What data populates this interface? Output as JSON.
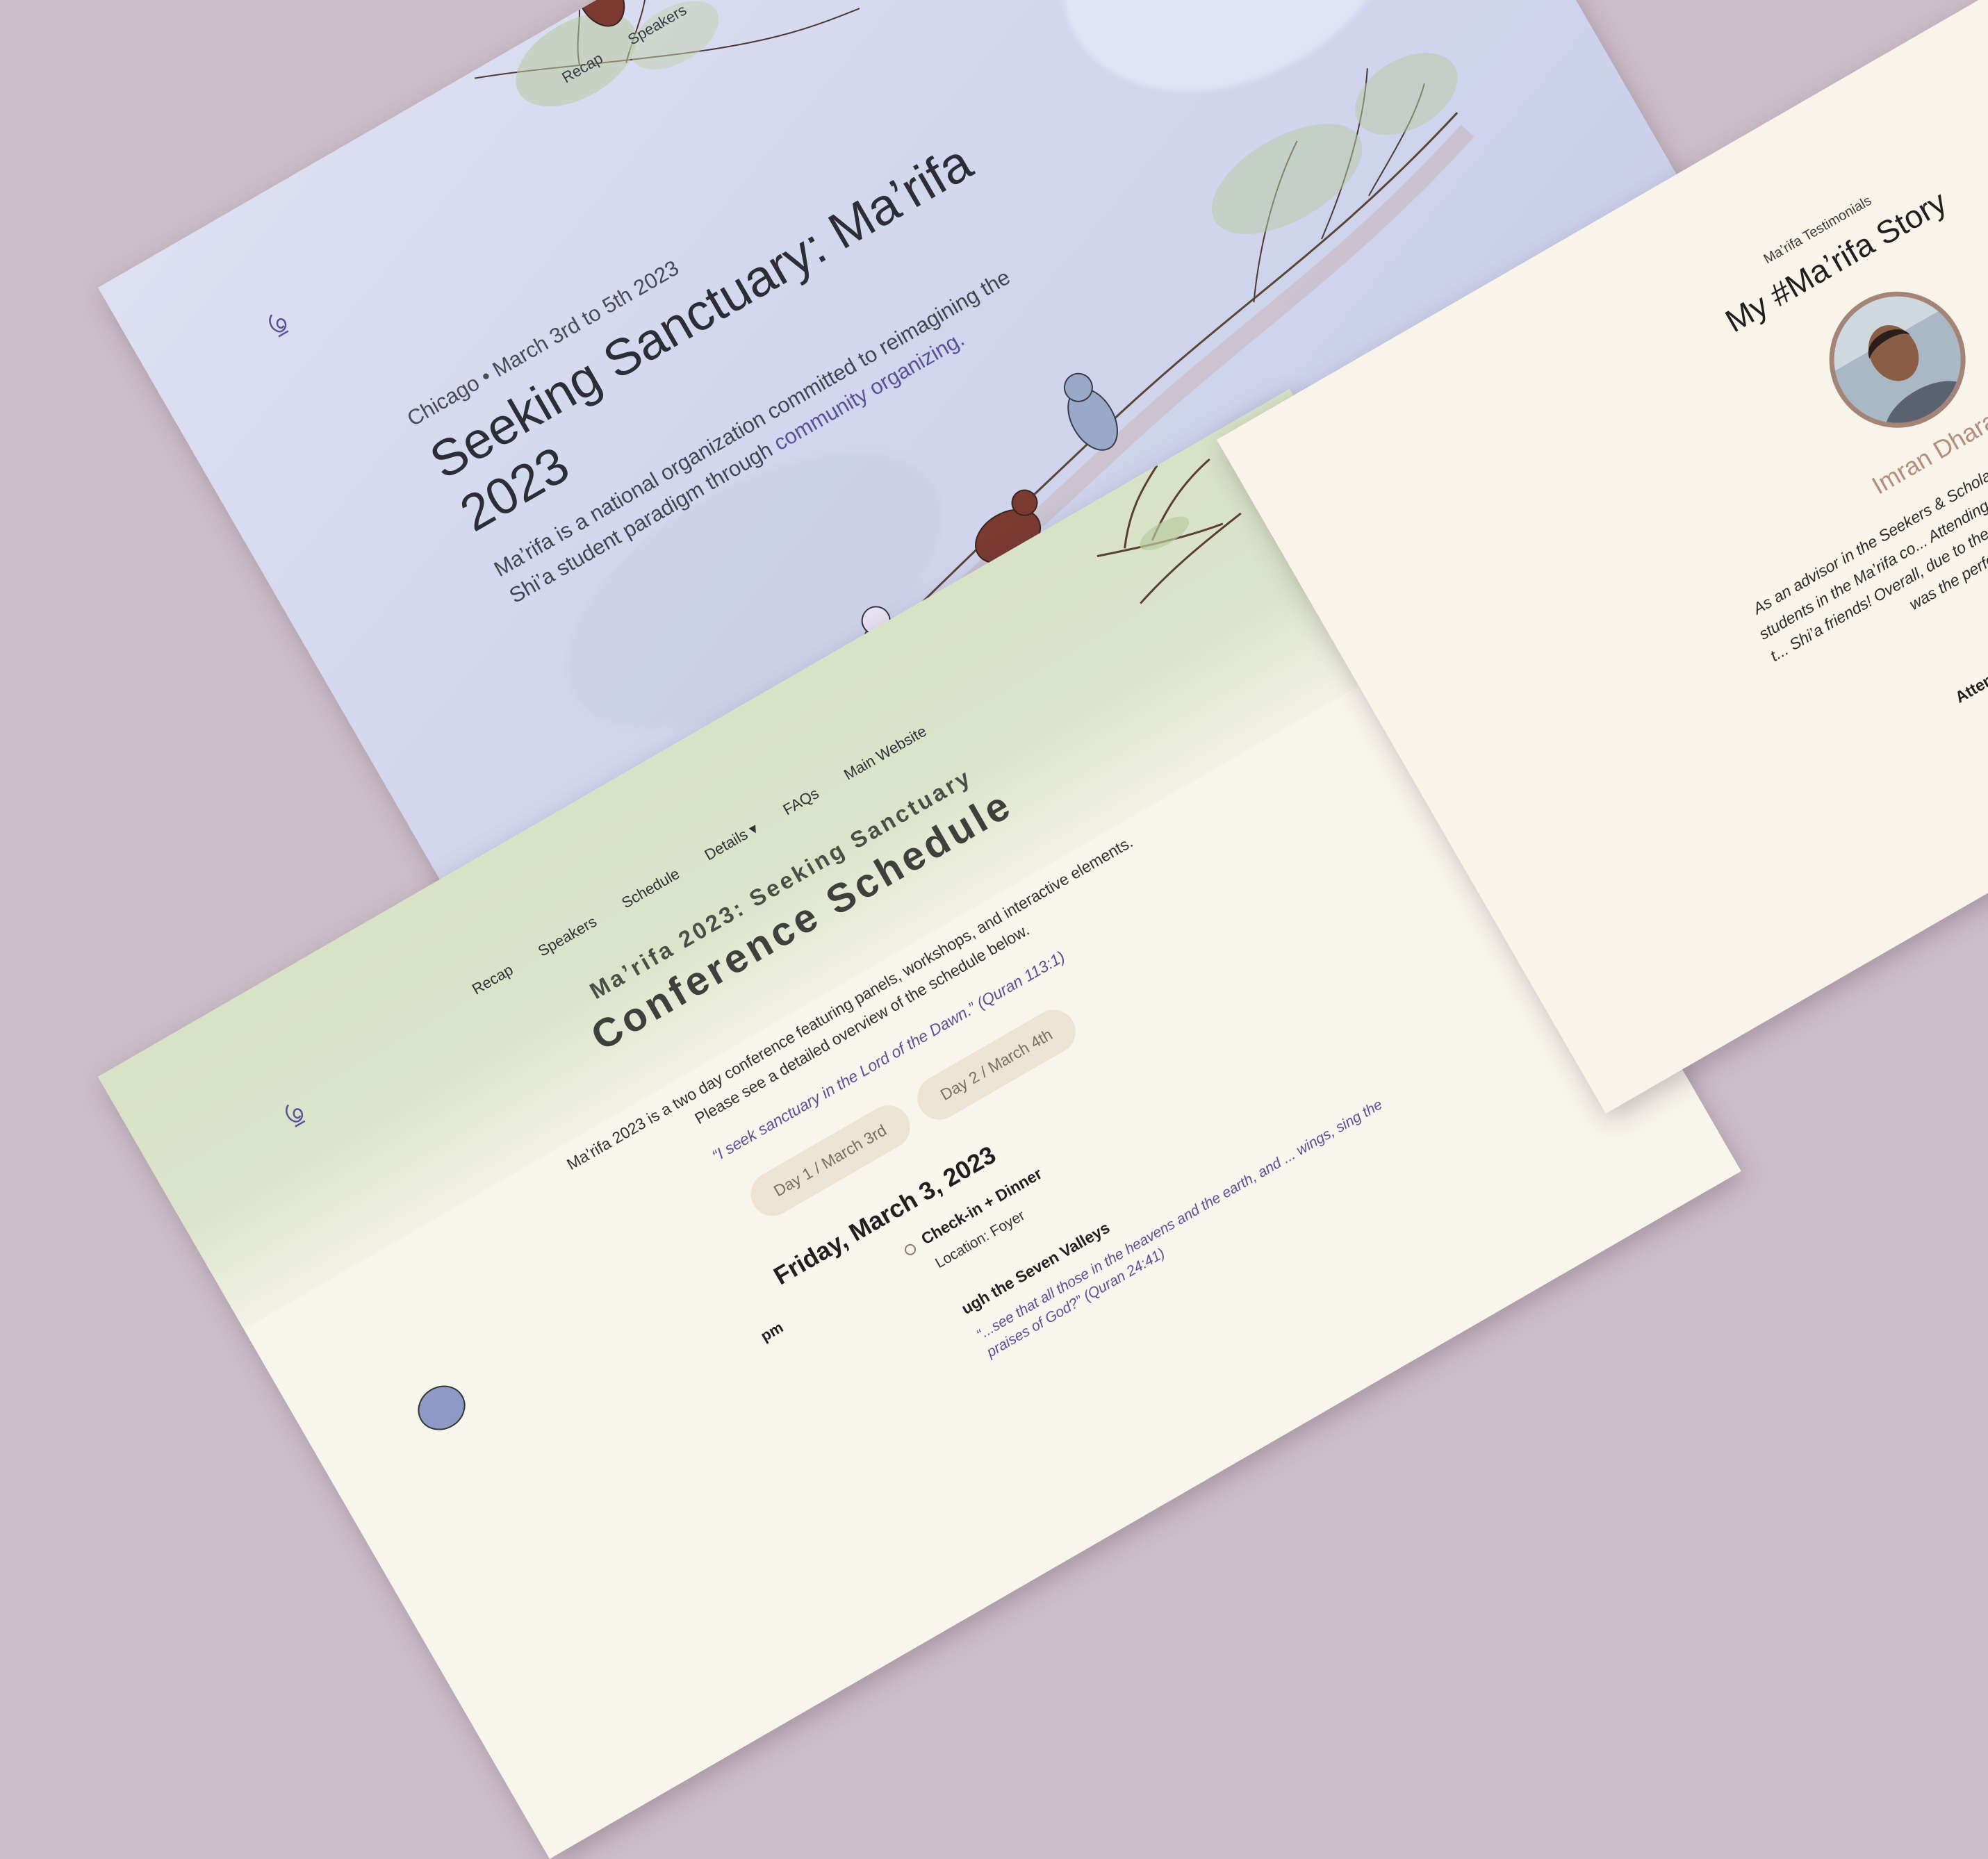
{
  "hero": {
    "nav": [
      "Recap",
      "Speakers"
    ],
    "meta": "Chicago • March 3rd to 5th 2023",
    "title": "Seeking Sanctuary: Ma’rifa 2023",
    "desc_prefix": "Ma’rifa is a national organization committed to reimagining the Shi’a student paradigm through ",
    "desc_accent": "community organizing."
  },
  "schedule": {
    "nav": [
      "Recap",
      "Speakers",
      "Schedule",
      "Details",
      "FAQs",
      "Main Website"
    ],
    "subtitle": "Ma’rifa 2023: Seeking Sanctuary",
    "title": "Conference Schedule",
    "intro": "Ma’rifa 2023 is a two day conference featuring panels, workshops, and interactive elements. Please see a detailed overview of the schedule below.",
    "quote1": "“I seek sanctuary in the Lord of the Dawn.” (Quran 113:1)",
    "tabs": [
      "Day 1 / March 3rd",
      "Day 2 / March 4th"
    ],
    "date": "Friday, March 3, 2023",
    "event_time": "pm",
    "event_title": "Check-in + Dinner",
    "event_location": "Location: Foyer",
    "event2_title": "ugh the Seven Valleys",
    "quote2": "“...see that all those in the heavens and the earth, and ... wings, sing the praises of God?” (Quran 24:41)"
  },
  "testimonial": {
    "eyebrow": "Ma’rifa Testimonials",
    "title": "My #Ma’rifa Story",
    "name": "Imran Dharam",
    "quote": "As an advisor in the Seekers & Scholars progr... meeting many fellow students in the Ma’rifa co... Attending the 2022 conference provided me t... Shi’a friends! Overall, due to the inspiring sc... 2022: Heart & Revival was the perfect way t... Ram...",
    "role": "Attendee, Seekers and Scho..."
  },
  "colors": {
    "background": "#cdbfc9",
    "hero_bg": "#d3d7ee",
    "accent_purple": "#5b4f96",
    "cream": "#f8f5ec",
    "sage": "#d8e2c6",
    "tab_bg": "#ebe3d3",
    "rust_bird": "#7b3b32",
    "blue_bird": "#9aa8c8",
    "avatar_border": "#a48477"
  },
  "icons": [
    "maarifa-logo-icon",
    "caret-down-icon",
    "bird-icon",
    "branch-icon"
  ]
}
